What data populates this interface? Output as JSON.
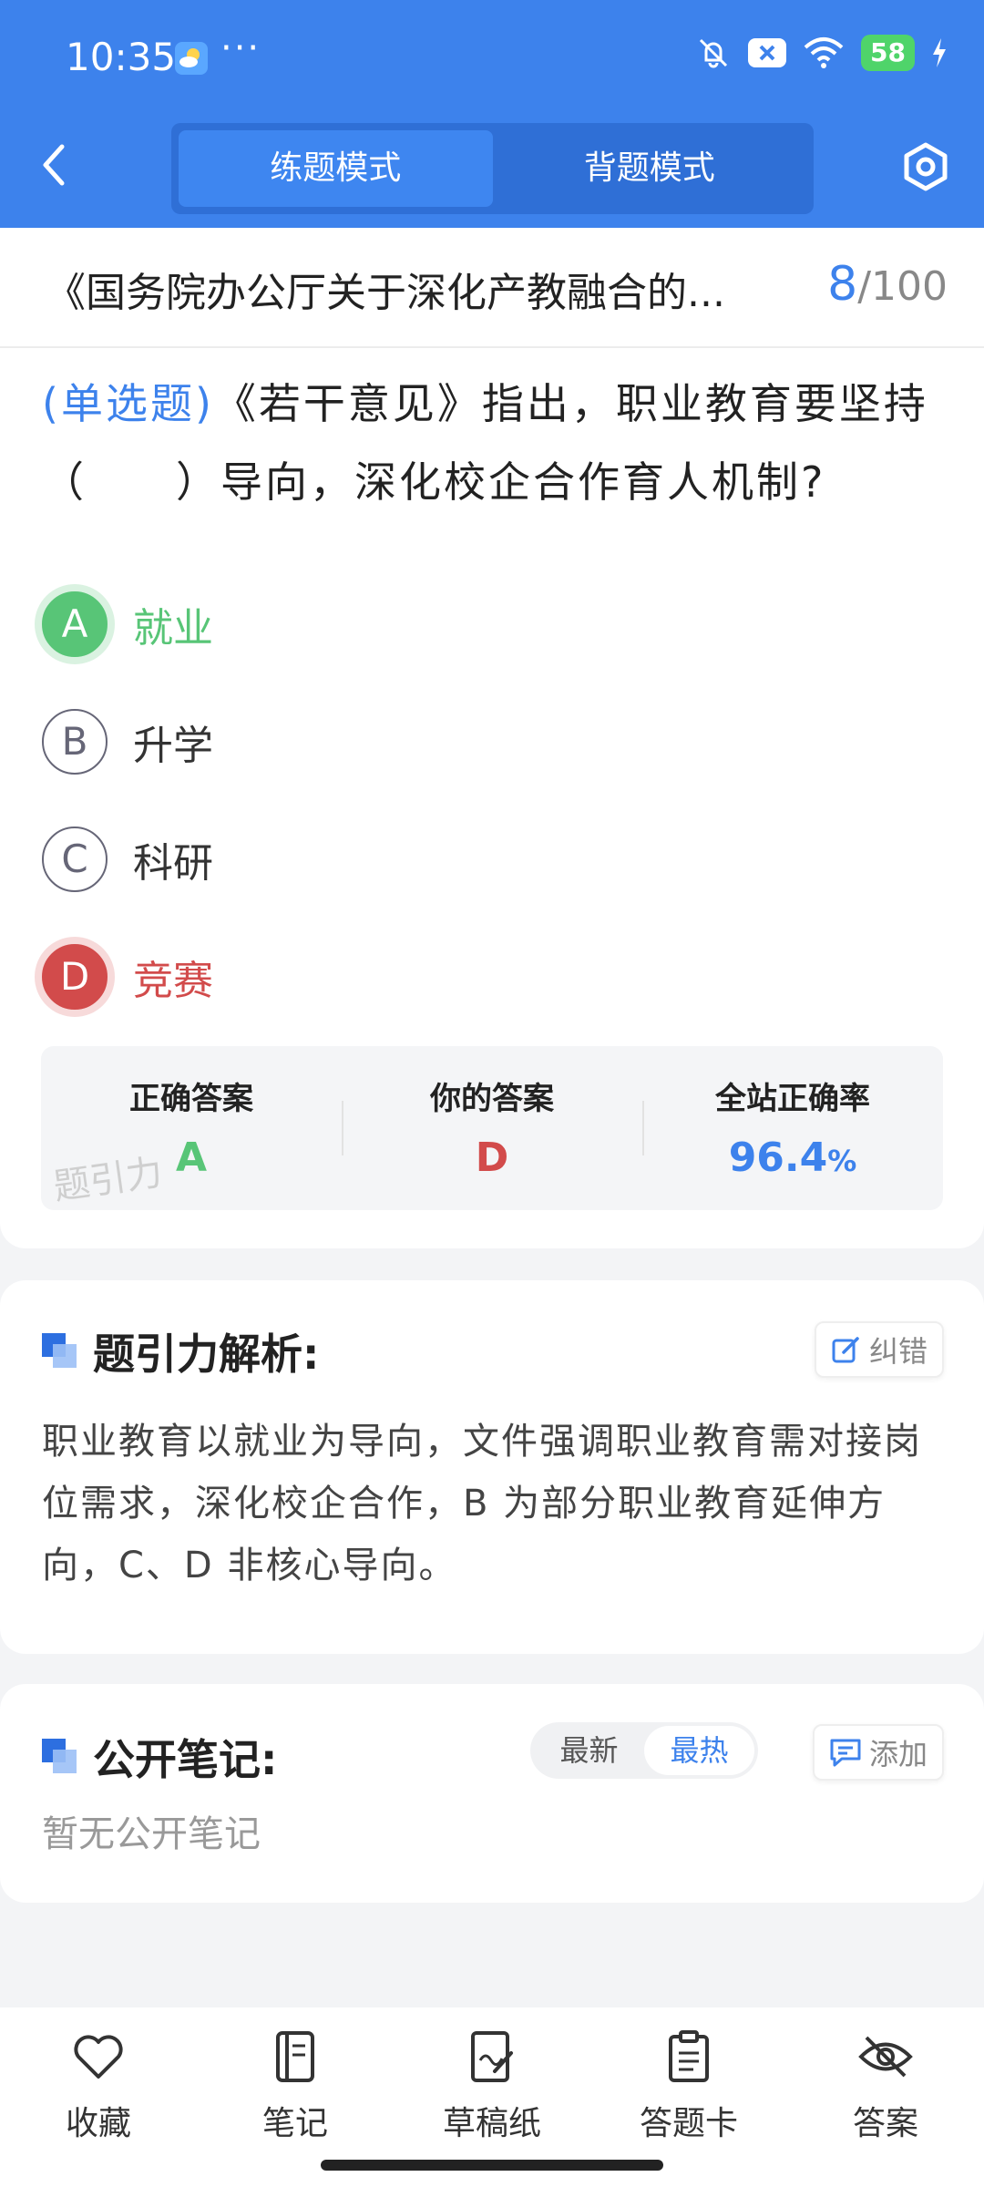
{
  "status_bar": {
    "time": "10:35",
    "more": "···",
    "battery": "58"
  },
  "header": {
    "tabs": [
      "练题模式",
      "背题模式"
    ],
    "active_tab": 0
  },
  "question_header": {
    "title": "《国务院办公厅关于深化产教融合的...",
    "current": "8",
    "total": "/100"
  },
  "question": {
    "type_label": "(单选题)",
    "text": "《若干意见》指出，职业教育要坚持（　　）导向，深化校企合作育人机制?",
    "options": [
      {
        "letter": "A",
        "text": "就业",
        "state": "correct"
      },
      {
        "letter": "B",
        "text": "升学",
        "state": "normal"
      },
      {
        "letter": "C",
        "text": "科研",
        "state": "normal"
      },
      {
        "letter": "D",
        "text": "竞赛",
        "state": "wrong"
      }
    ]
  },
  "stats": {
    "correct_label": "正确答案",
    "correct_value": "A",
    "yours_label": "你的答案",
    "yours_value": "D",
    "rate_label": "全站正确率",
    "rate_value": "96.4",
    "rate_unit": "%"
  },
  "watermark": "题引力",
  "analysis": {
    "title": "题引力解析:",
    "fix_label": "纠错",
    "text": "职业教育以就业为导向，文件强调职业教育需对接岗位需求，深化校企合作，B 为部分职业教育延伸方向，C、D 非核心导向。"
  },
  "notes": {
    "title": "公开笔记:",
    "sort_options": [
      "最新",
      "最热"
    ],
    "active_sort": 1,
    "add_label": "添加",
    "empty_text": "暂无公开笔记"
  },
  "tabbar": [
    {
      "label": "收藏",
      "icon": "heart-icon"
    },
    {
      "label": "笔记",
      "icon": "notebook-icon"
    },
    {
      "label": "草稿纸",
      "icon": "draft-paper-icon"
    },
    {
      "label": "答题卡",
      "icon": "answer-card-icon"
    },
    {
      "label": "答案",
      "icon": "eye-off-icon"
    }
  ],
  "colors": {
    "brand": "#3d82ec",
    "correct": "#58c577",
    "wrong": "#d24b4b"
  }
}
